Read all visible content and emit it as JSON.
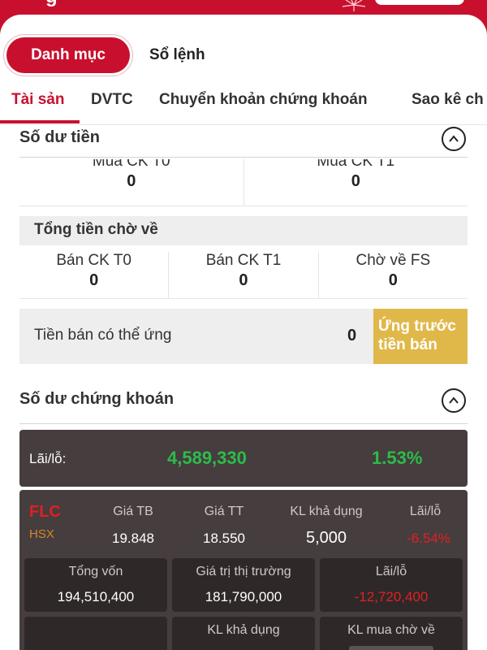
{
  "header": {
    "title_fragment": "g"
  },
  "order_tabs": [
    {
      "label": "Danh mục",
      "active": true
    },
    {
      "label": "Sổ lệnh",
      "active": false
    }
  ],
  "sub_tabs": [
    {
      "label": "Tài sản",
      "active": true
    },
    {
      "label": "DVTC",
      "active": false
    },
    {
      "label": "Chuyển khoản chứng khoán",
      "active": false
    },
    {
      "label": "Sao kê ch",
      "active": false
    }
  ],
  "cash_balance": {
    "title": "Số dư tiền",
    "collapse_icon": "chevron-up-icon",
    "buy_cells": [
      {
        "label": "Mua CK T0",
        "value": "0"
      },
      {
        "label": "Mua CK T1",
        "value": "0"
      }
    ],
    "pending_title": "Tổng tiền chờ về",
    "pending_cells": [
      {
        "label": "Bán CK T0",
        "value": "0"
      },
      {
        "label": "Bán CK T1",
        "value": "0"
      },
      {
        "label": "Chờ về FS",
        "value": "0"
      }
    ],
    "advance": {
      "label": "Tiền bán có thể ứng",
      "value": "0",
      "button_line1": "Ứng trước",
      "button_line2": "tiền bán"
    }
  },
  "securities_balance": {
    "title": "Số dư chứng khoán",
    "collapse_icon": "chevron-up-icon",
    "profit_loss": {
      "label": "Lãi/lỗ:",
      "amount": "4,589,330",
      "percent": "1.53%"
    },
    "holding": {
      "symbol": "FLC",
      "exchange": "HSX",
      "headers": [
        "Giá TB",
        "Giá TT",
        "KL khả dụng",
        "Lãi/lỗ"
      ],
      "values": [
        "19.848",
        "18.550",
        "5,000",
        "-6.54%"
      ],
      "boxes": [
        {
          "label": "Tổng vốn",
          "value": "194,510,400"
        },
        {
          "label": "Giá trị thị trường",
          "value": "181,790,000"
        },
        {
          "label": "Lãi/lỗ",
          "value": "-12,720,400"
        }
      ],
      "boxes2": [
        {
          "label": ""
        },
        {
          "label": "KL khả dụng"
        },
        {
          "label": "KL mua chờ về"
        }
      ]
    }
  },
  "colors": {
    "brand_red": "#c8102e",
    "gain_green": "#2bbd4a",
    "loss_red": "#e02020",
    "advance_gold": "#e0b84a"
  }
}
